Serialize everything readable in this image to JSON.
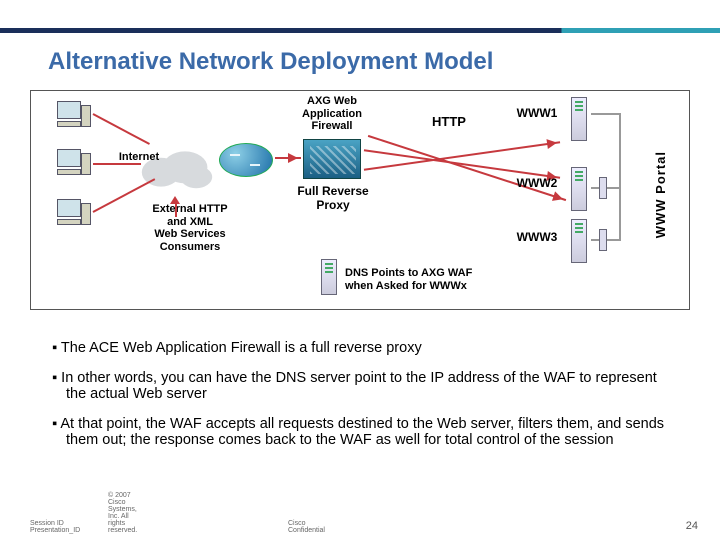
{
  "title": "Alternative Network Deployment Model",
  "diagram": {
    "axg": "AXG Web\nApplication\nFirewall",
    "http": "HTTP",
    "internet": "Internet",
    "external": "External HTTP\nand XML\nWeb Services\nConsumers",
    "frp": "Full Reverse\nProxy",
    "www1": "WWW1",
    "www2": "WWW2",
    "www3": "WWW3",
    "portal": "WWW Portal",
    "dns": "DNS Points to AXG WAF\nwhen Asked for WWWx"
  },
  "bullets": [
    "The ACE Web Application Firewall is a full reverse proxy",
    "In other words, you can have the DNS server point to the IP address of the WAF to represent the actual Web server",
    "At that point, the WAF accepts all requests destined to the Web server, filters them, and sends them out; the response comes back to the WAF as well for total control of the session"
  ],
  "footer": {
    "left1": "Session ID",
    "left2": "Presentation_ID",
    "copy": "© 2007 Cisco Systems, Inc. All rights reserved.",
    "conf": "Cisco Confidential",
    "page": "24"
  }
}
